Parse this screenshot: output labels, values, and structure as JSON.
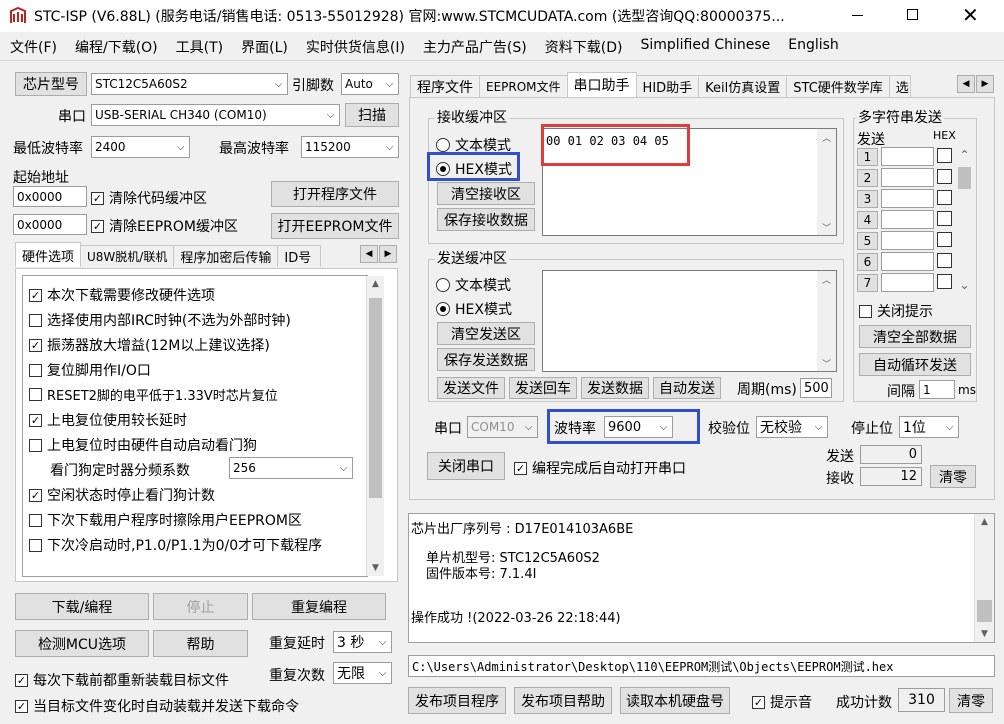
{
  "window": {
    "title": "STC-ISP (V6.88L) (服务电话/销售电话: 0513-55012928) 官网:www.STCMCUDATA.com  (选型咨询QQ:80000375..."
  },
  "menu": [
    "文件(F)",
    "编程/下载(O)",
    "工具(T)",
    "界面(L)",
    "实时供货信息(I)",
    "主力产品广告(S)",
    "资料下载(D)",
    "Simplified Chinese",
    "English"
  ],
  "left": {
    "chip_button": "芯片型号",
    "chip_value": "STC12C5A60S2",
    "pin_label": "引脚数",
    "pin_value": "Auto",
    "port_label": "串口",
    "port_value": "USB-SERIAL CH340 (COM10)",
    "scan_button": "扫描",
    "min_baud_label": "最低波特率",
    "min_baud_value": "2400",
    "max_baud_label": "最高波特率",
    "max_baud_value": "115200",
    "start_addr_label": "起始地址",
    "addr1": "0x0000",
    "clear_code": "清除代码缓冲区",
    "open_prog": "打开程序文件",
    "addr2": "0x0000",
    "clear_eeprom": "清除EEPROM缓冲区",
    "open_eeprom": "打开EEPROM文件",
    "tabs": [
      "硬件选项",
      "U8W脱机/联机",
      "程序加密后传输",
      "ID号"
    ],
    "options": [
      {
        "label": "本次下载需要修改硬件选项",
        "checked": "✓"
      },
      {
        "label": "选择使用内部IRC时钟(不选为外部时钟)",
        "checked": ""
      },
      {
        "label": "振荡器放大增益(12M以上建议选择)",
        "checked": "✓"
      },
      {
        "label": "复位脚用作I/O口",
        "checked": ""
      },
      {
        "label": "RESET2脚的电平低于1.33V时芯片复位",
        "checked": ""
      },
      {
        "label": "上电复位使用较长延时",
        "checked": "✓"
      },
      {
        "label": "上电复位时由硬件自动启动看门狗",
        "checked": ""
      }
    ],
    "wdt_label": "看门狗定时器分频系数",
    "wdt_value": "256",
    "options2": [
      {
        "label": "空闲状态时停止看门狗计数",
        "checked": "✓"
      },
      {
        "label": "下次下载用户程序时擦除用户EEPROM区",
        "checked": ""
      },
      {
        "label": "下次冷启动时,P1.0/P1.1为0/0才可下载程序",
        "checked": ""
      }
    ],
    "download": "下载/编程",
    "stop": "停止",
    "reprogram": "重复编程",
    "detect": "检测MCU选项",
    "help": "帮助",
    "repeat_delay_label": "重复延时",
    "repeat_delay_value": "3 秒",
    "repeat_count_label": "重复次数",
    "repeat_count_value": "无限",
    "reload_each": "每次下载前都重新装载目标文件",
    "auto_reload": "当目标文件变化时自动装载并发送下载命令"
  },
  "right": {
    "tabs": [
      "程序文件",
      "EEPROM文件",
      "串口助手",
      "HID助手",
      "Keil仿真设置",
      "STC硬件数学库",
      "选"
    ],
    "recv_group": "接收缓冲区",
    "text_mode": "文本模式",
    "hex_mode": "HEX模式",
    "clear_recv": "清空接收区",
    "save_recv": "保存接收数据",
    "recv_data": "00 01 02 03 04 05",
    "send_group": "发送缓冲区",
    "clear_send": "清空发送区",
    "save_send": "保存发送数据",
    "send_file": "发送文件",
    "send_enter": "发送回车",
    "send_data": "发送数据",
    "auto_send": "自动发送",
    "period_label": "周期(ms)",
    "period_value": "500",
    "multi_group": "多字符串发送",
    "send_col": "发送",
    "hex_col": "HEX",
    "rows": [
      "1",
      "2",
      "3",
      "4",
      "5",
      "6",
      "7"
    ],
    "close_hint": "关闭提示",
    "clear_all": "清空全部数据",
    "auto_loop": "自动循环发送",
    "interval_label": "间隔",
    "interval_value": "1",
    "interval_unit": "ms",
    "port_label": "串口",
    "port_value": "COM10",
    "baud_label": "波特率",
    "baud_value": "9600",
    "parity_label": "校验位",
    "parity_value": "无校验",
    "stop_label": "停止位",
    "stop_value": "1位",
    "close_port": "关闭串口",
    "auto_open": "编程完成后自动打开串口",
    "sent_label": "发送",
    "sent_value": "0",
    "recv_label": "接收",
    "recv_value": "12",
    "clear_count": "清零"
  },
  "log": {
    "serial": "芯片出厂序列号 : D17E014103A6BE",
    "model": "单片机型号: STC12C5A60S2",
    "fw": "固件版本号: 7.1.4I",
    "result": "操作成功 !(2022-03-26 22:18:44)"
  },
  "path": "C:\\Users\\Administrator\\Desktop\\110\\EEPROM测试\\Objects\\EEPROM测试.hex",
  "bottom": {
    "publish_prog": "发布项目程序",
    "publish_help": "发布项目帮助",
    "read_disk": "读取本机硬盘号",
    "sound": "提示音",
    "success_label": "成功计数",
    "success_value": "310",
    "clear": "清零"
  },
  "colors": {
    "red_highlight": "#e03c3c",
    "blue_highlight": "#3050d0"
  }
}
